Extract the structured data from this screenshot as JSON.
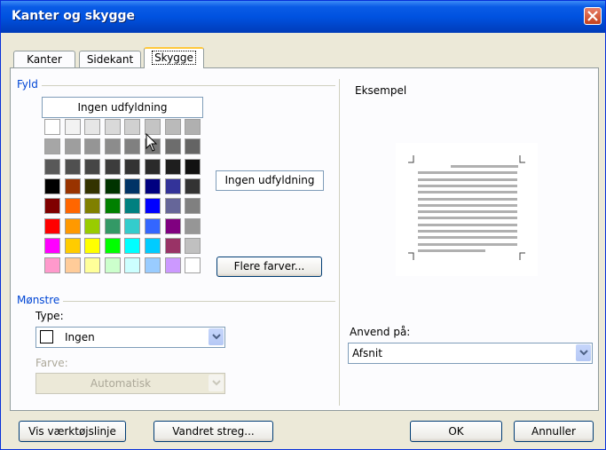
{
  "window": {
    "title": "Kanter og skygge",
    "close_label": "×"
  },
  "tabs": [
    {
      "label": "Kanter",
      "active": false
    },
    {
      "label": "Sidekant",
      "active": false
    },
    {
      "label": "Skygge",
      "active": true
    }
  ],
  "fill": {
    "group_label": "Fyld",
    "no_fill_top": "Ingen udfyldning",
    "no_fill_side": "Ingen udfyldning",
    "more_colors": "Flere farver...",
    "palette": [
      [
        "#ffffff",
        "#f2f2f2",
        "#e6e6e6",
        "#d9d9d9",
        "#d0d0d0",
        "#c4c4c4",
        "#bababa",
        "#b0b0b0"
      ],
      [
        "#a6a6a6",
        "#9e9e9e",
        "#959595",
        "#8c8c8c",
        "#808080",
        "#777777",
        "#6d6d6d",
        "#646464"
      ],
      [
        "#595959",
        "#505050",
        "#464646",
        "#3c3c3c",
        "#333333",
        "#2a2a2a",
        "#1e1e1e",
        "#111111"
      ],
      [
        "#000000",
        "#993300",
        "#333300",
        "#003300",
        "#003366",
        "#000080",
        "#333399",
        "#333333"
      ],
      [
        "#800000",
        "#ff6600",
        "#808000",
        "#008000",
        "#008080",
        "#0000ff",
        "#666699",
        "#808080"
      ],
      [
        "#ff0000",
        "#ff9900",
        "#99cc00",
        "#339966",
        "#33cccc",
        "#3366ff",
        "#800080",
        "#969696"
      ],
      [
        "#ff00ff",
        "#ffcc00",
        "#ffff00",
        "#00ff00",
        "#00ffff",
        "#00ccff",
        "#993366",
        "#c0c0c0"
      ],
      [
        "#ff99cc",
        "#ffcc99",
        "#ffff99",
        "#ccffcc",
        "#ccffff",
        "#99ccff",
        "#cc99ff",
        "#ffffff"
      ]
    ]
  },
  "patterns": {
    "group_label": "Mønstre",
    "type_label": "Type:",
    "type_value": "Ingen",
    "color_label": "Farve:",
    "color_value": "Automatisk"
  },
  "preview": {
    "label": "Eksempel"
  },
  "apply": {
    "label": "Anvend på:",
    "value": "Afsnit"
  },
  "footer": {
    "toolbar_button": "Vis værktøjslinje",
    "horizontal_line_button": "Vandret streg...",
    "ok_button": "OK",
    "cancel_button": "Annuller"
  },
  "colors": {
    "title_bar": "#0052e0",
    "accent": "#0046d5",
    "close": "#c4401c"
  }
}
